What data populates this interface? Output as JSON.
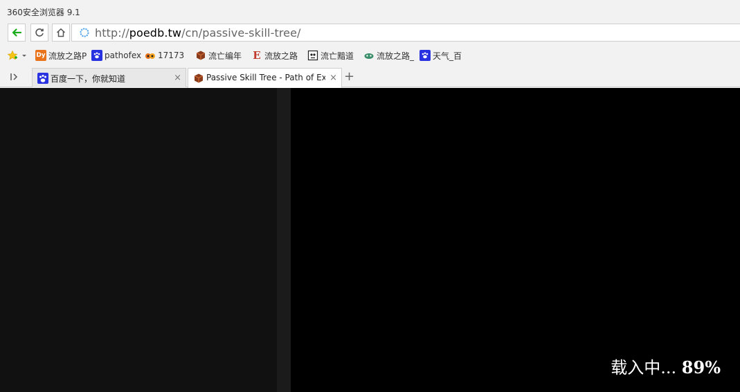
{
  "window": {
    "title": "360安全浏览器 9.1"
  },
  "address_bar": {
    "scheme": "http://",
    "host": "poedb.tw",
    "path": "/cn/passive-skill-tree/"
  },
  "bookmarks": [
    {
      "label": "流放之路P",
      "icon": "dy-icon",
      "color": "#e8731a"
    },
    {
      "label": "pathofex",
      "icon": "baidu-paw-icon",
      "color": "#2932e1"
    },
    {
      "label": "17173",
      "icon": "17173-icon",
      "color": "#e8731a"
    },
    {
      "label": "流亡编年",
      "icon": "cube-icon",
      "color": "#8a3b1c"
    },
    {
      "label": "流放之路",
      "icon": "e-logo-icon",
      "color": "#c0392b"
    },
    {
      "label": "流亡黯道",
      "icon": "skull-icon",
      "color": "#222222"
    },
    {
      "label": "流放之路_",
      "icon": "bird-icon",
      "color": "#3a8f6a"
    },
    {
      "label": "天气_百",
      "icon": "baidu-paw-icon",
      "color": "#2932e1"
    }
  ],
  "tabs": [
    {
      "label": "百度一下，你就知道",
      "icon": "baidu-paw-icon",
      "active": false
    },
    {
      "label": "Passive Skill Tree - Path of Exi",
      "icon": "cube-icon",
      "active": true
    }
  ],
  "page": {
    "loading_label": "载入中...",
    "loading_percent": "89%"
  },
  "colors": {
    "accent_green": "#1aad19",
    "chrome_bg": "#f2f2f2",
    "page_bg": "#000000"
  }
}
